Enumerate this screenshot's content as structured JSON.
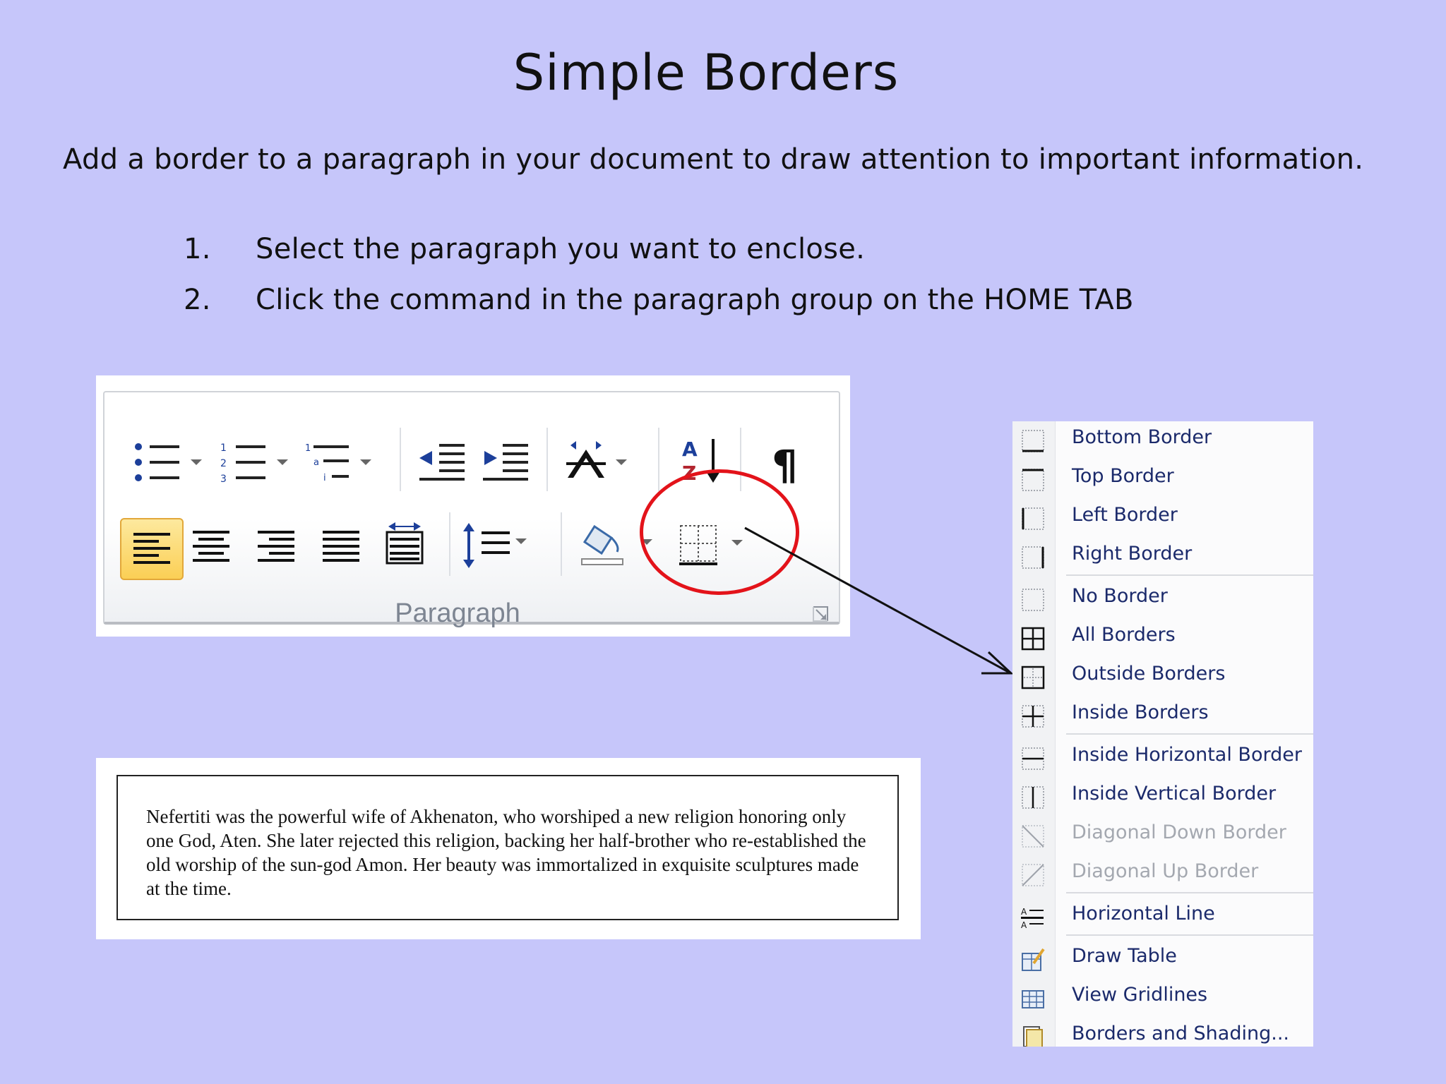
{
  "slide": {
    "title": "Simple Borders",
    "intro": "Add a border to a paragraph in your document to draw attention to important information.",
    "steps": [
      {
        "num": "1.",
        "text": "Select the paragraph you want to enclose."
      },
      {
        "num": "2.",
        "text": "Click the command in the paragraph group on the HOME TAB"
      }
    ]
  },
  "ribbon": {
    "group_label": "Paragraph"
  },
  "sample": {
    "text": "Nefertiti was the powerful wife of Akhenaton, who worshiped a new religion honoring only one God, Aten. She later rejected this religion, backing her half-brother who re-established the old worship of the sun-god Amon. Her beauty was immortalized in exquisite sculptures made at the time."
  },
  "menu": {
    "items": [
      {
        "label": "Bottom Border",
        "icon": "bottom-border-icon"
      },
      {
        "label": "Top Border",
        "icon": "top-border-icon"
      },
      {
        "label": "Left Border",
        "icon": "left-border-icon"
      },
      {
        "label": "Right Border",
        "icon": "right-border-icon"
      },
      {
        "label": "No Border",
        "icon": "no-border-icon"
      },
      {
        "label": "All Borders",
        "icon": "all-borders-icon"
      },
      {
        "label": "Outside Borders",
        "icon": "outside-borders-icon"
      },
      {
        "label": "Inside Borders",
        "icon": "inside-borders-icon"
      },
      {
        "label": "Inside Horizontal Border",
        "icon": "inside-horizontal-border-icon"
      },
      {
        "label": "Inside Vertical Border",
        "icon": "inside-vertical-border-icon"
      },
      {
        "label": "Diagonal Down Border",
        "icon": "diagonal-down-border-icon",
        "disabled": true
      },
      {
        "label": "Diagonal Up Border",
        "icon": "diagonal-up-border-icon",
        "disabled": true
      },
      {
        "label": "Horizontal Line",
        "icon": "horizontal-line-icon"
      },
      {
        "label": "Draw Table",
        "icon": "draw-table-icon"
      },
      {
        "label": "View Gridlines",
        "icon": "view-gridlines-icon"
      },
      {
        "label": "Borders and Shading...",
        "icon": "borders-and-shading-icon"
      }
    ]
  },
  "colors": {
    "background": "#c6c6fa",
    "highlight_button": "#fcd96a",
    "circle": "#e3131a",
    "menu_text": "#1b2a6b",
    "menu_text_disabled": "#a4a8b0"
  }
}
